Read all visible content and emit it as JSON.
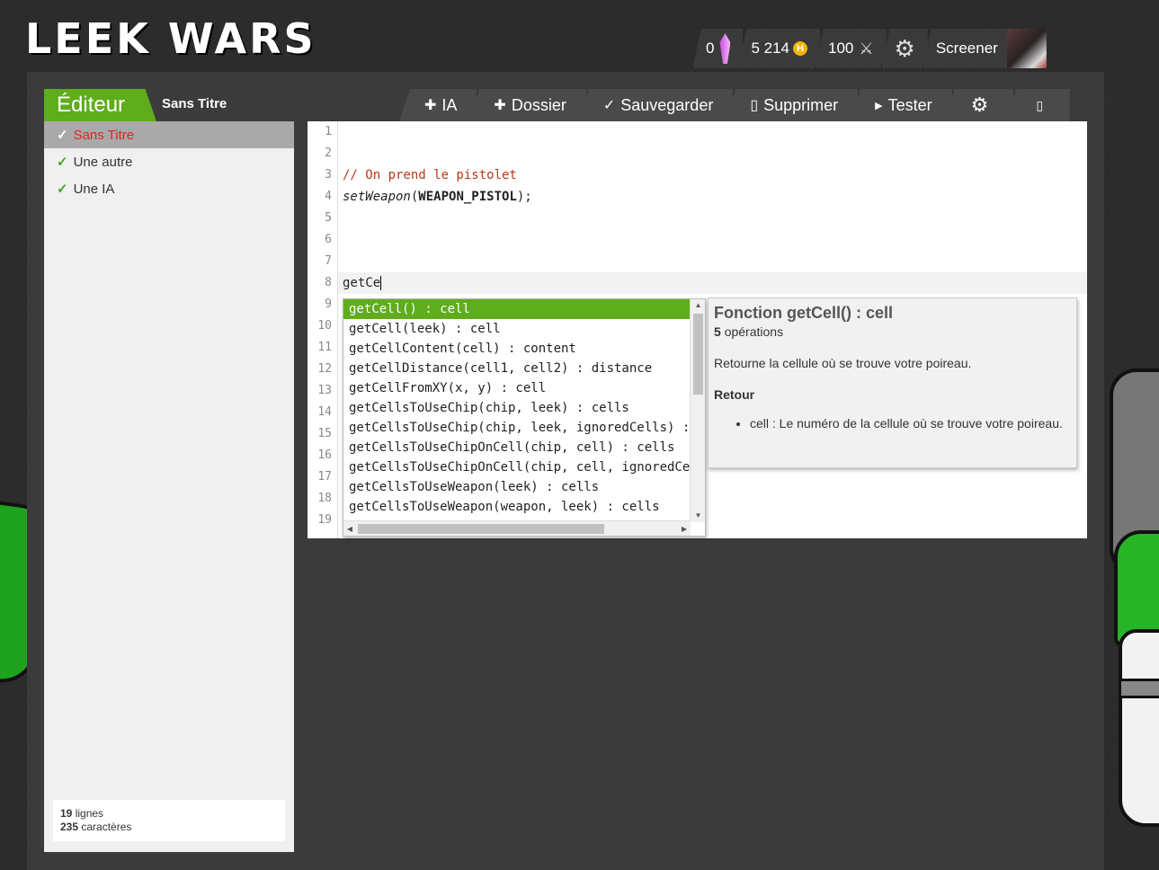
{
  "header": {
    "logo": "LEEK WARS",
    "crystals": "0",
    "habs": "5 214",
    "habs_symbol": "H",
    "fights": "100",
    "username": "Screener"
  },
  "editor_tab": {
    "label": "Éditeur",
    "current_file": "Sans Titre"
  },
  "toolbar": {
    "new_ai": "IA",
    "new_folder": "Dossier",
    "save": "Sauvegarder",
    "delete": "Supprimer",
    "test": "Tester"
  },
  "sidebar": {
    "items": [
      {
        "label": "Sans Titre"
      },
      {
        "label": "Une autre"
      },
      {
        "label": "Une IA"
      }
    ],
    "stats": {
      "lines_count": "19",
      "lines_label": "lignes",
      "chars_count": "235",
      "chars_label": "caractères"
    }
  },
  "code": {
    "line_numbers": [
      "1",
      "2",
      "3",
      "4",
      "5",
      "6",
      "7",
      "8",
      "9",
      "10",
      "11",
      "12",
      "13",
      "14",
      "15",
      "16",
      "17",
      "18",
      "19"
    ],
    "line3_comment": "// On prend le pistolet",
    "line4_fn": "setWeapon",
    "line4_open": "(",
    "line4_const": "WEAPON_PISTOL",
    "line4_close": ");",
    "line8": "getCe"
  },
  "autocomplete": {
    "items": [
      "getCell() : cell",
      "getCell(leek) : cell",
      "getCellContent(cell) : content",
      "getCellDistance(cell1, cell2) : distance",
      "getCellFromXY(x, y) : cell",
      "getCellsToUseChip(chip, leek) : cells",
      "getCellsToUseChip(chip, leek, ignoredCells) : cells",
      "getCellsToUseChipOnCell(chip, cell) : cells",
      "getCellsToUseChipOnCell(chip, cell, ignoredCells) : cells",
      "getCellsToUseWeapon(leek) : cells",
      "getCellsToUseWeapon(weapon, leek) : cells"
    ]
  },
  "doc": {
    "title": "Fonction getCell() : cell",
    "ops_count": "5",
    "ops_label": "opérations",
    "description": "Retourne la cellule où se trouve votre poireau.",
    "return_heading": "Retour",
    "return_item": "cell : Le numéro de la cellule où se trouve votre poireau."
  },
  "icons": {
    "crystal": "crystal-icon",
    "coin": "habs-coin-icon",
    "sword": "sword-icon",
    "settings": "gear-icon",
    "check": "check-icon",
    "plus": "plus-icon",
    "delete": "trash-icon",
    "play": "play-icon",
    "fullscreen": "fullscreen-icon"
  },
  "colors": {
    "accent": "#5fad1b",
    "selected_text": "#e02222",
    "comment": "#b53a1a"
  }
}
